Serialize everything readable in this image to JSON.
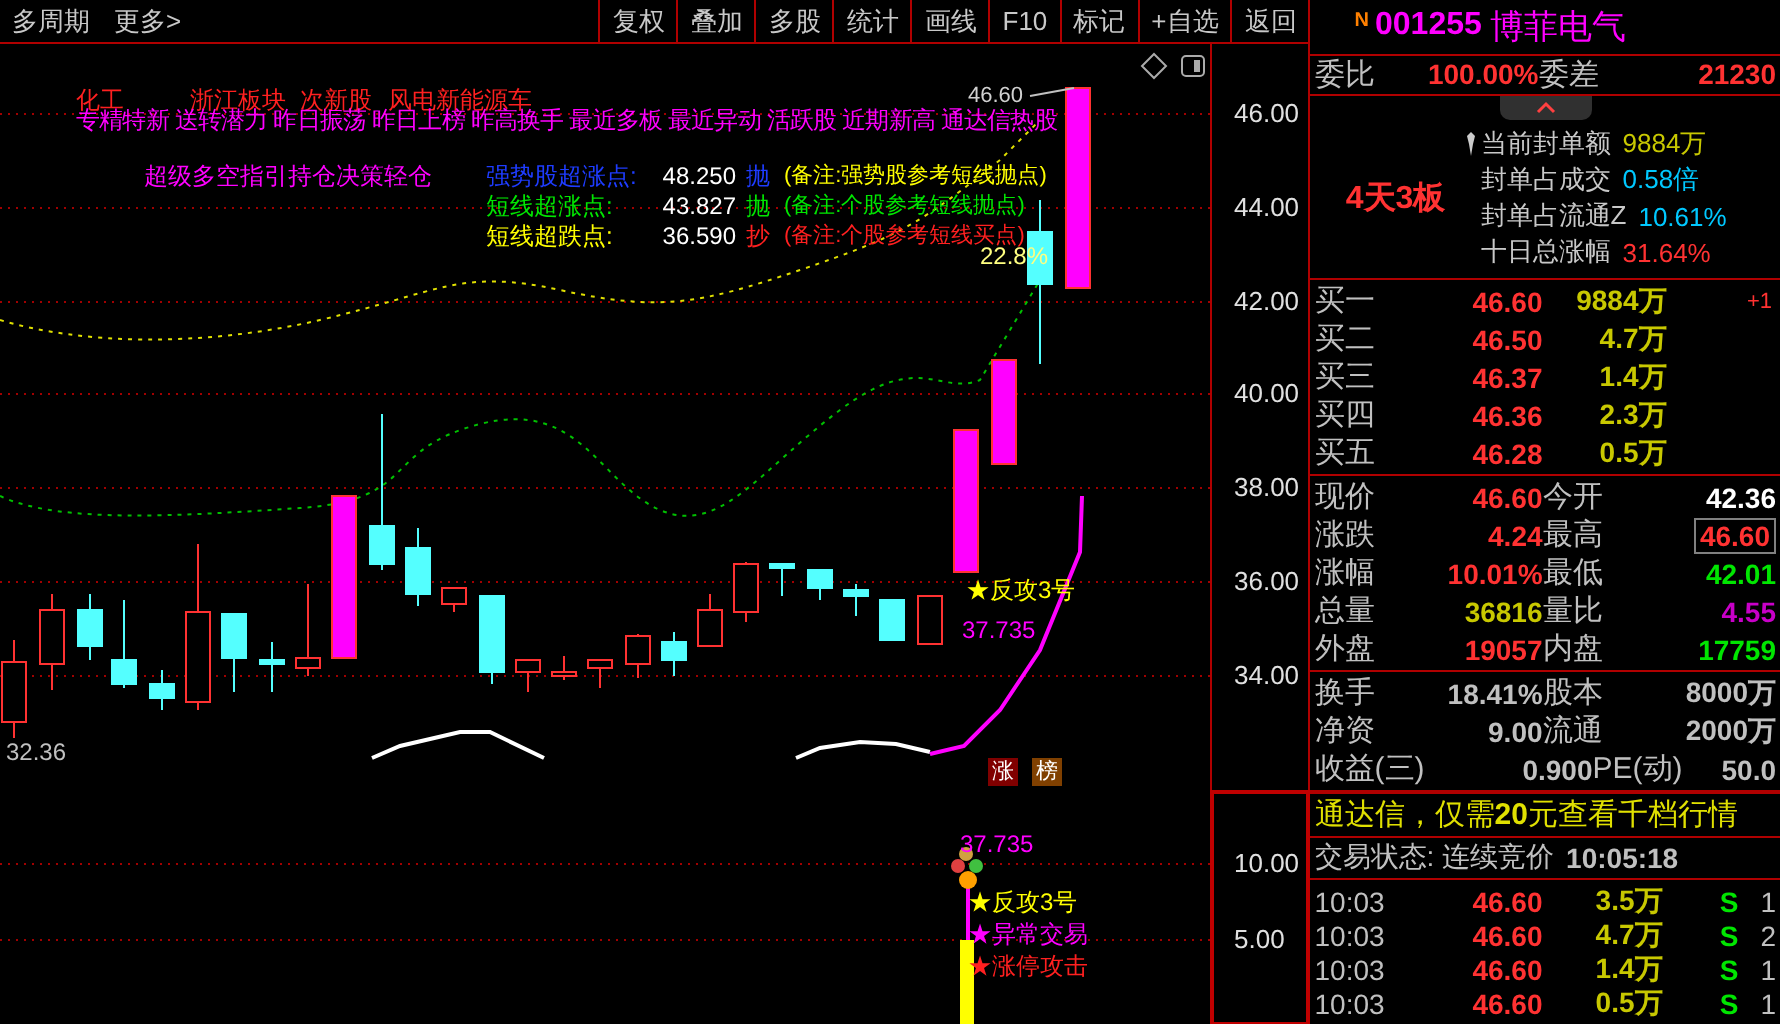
{
  "toolbar": {
    "left": [
      "多周期",
      "更多>"
    ],
    "buttons": [
      "复权",
      "叠加",
      "多股",
      "统计",
      "画线",
      "F10",
      "标记",
      "+自选",
      "返回"
    ]
  },
  "chart": {
    "price_axis": [
      "46.00",
      "44.00",
      "42.00",
      "40.00",
      "38.00",
      "36.00",
      "34.00"
    ],
    "concept_tags": [
      "化工",
      "浙江板块",
      "次新股",
      "风电",
      "新能源车"
    ],
    "feature_tags": "专精特新 送转潜力 昨日振荡 昨日上榜 昨高换手 最近多板 最近异动 活跃股 近期新高 通达信热股",
    "indicator_title": "超级多空指引持仓决策轻仓",
    "signals": [
      {
        "kind": "strong",
        "label": "强势股超涨点:",
        "value": "48.250",
        "action": "抛",
        "note": "(备注:强势股参考短线抛点)"
      },
      {
        "kind": "short_up",
        "label": "短线超涨点:",
        "value": "43.827",
        "action": "抛",
        "note": "(备注:个股参考短线抛点)"
      },
      {
        "kind": "short_down",
        "label": "短线超跌点:",
        "value": "36.590",
        "action": "抄",
        "note": "(备注:个股参考短线买点)"
      }
    ],
    "high_label": "46.60",
    "pct_label": "22.8%",
    "low_label": "32.36",
    "signal_label": "★反攻3号",
    "signal_value": "37.735",
    "badges": [
      "涨",
      "榜"
    ]
  },
  "sub_chart": {
    "axis": [
      "10.00",
      "5.00"
    ],
    "value": "37.735",
    "signals": [
      {
        "kind": "counter",
        "text": "★反攻3号"
      },
      {
        "kind": "abnormal",
        "text": "★异常交易"
      },
      {
        "kind": "limit",
        "text": "★涨停攻击"
      }
    ]
  },
  "quote": {
    "badge": "N",
    "code": "001255",
    "name": "博菲电气",
    "order_ratio": {
      "label": "委比",
      "value": "100.00%",
      "diff_label": "委差",
      "diff": "21230"
    },
    "board_tag": "4天3板",
    "seal": [
      {
        "label": "当前封单额",
        "value": "9884万",
        "kind": "volume"
      },
      {
        "label": "封单占成交",
        "value": "0.58倍",
        "kind": "info"
      },
      {
        "label": "封单占流通Z",
        "value": "10.61%",
        "kind": "info"
      },
      {
        "label": "十日总涨幅",
        "value": "31.64%",
        "kind": "up"
      }
    ],
    "bids": [
      {
        "label": "买一",
        "price": "46.60",
        "volume": "9884万",
        "change": "+1"
      },
      {
        "label": "买二",
        "price": "46.50",
        "volume": "4.7万"
      },
      {
        "label": "买三",
        "price": "46.37",
        "volume": "1.4万"
      },
      {
        "label": "买四",
        "price": "46.36",
        "volume": "2.3万"
      },
      {
        "label": "买五",
        "price": "46.28",
        "volume": "0.5万"
      }
    ],
    "stats": [
      [
        {
          "label": "现价",
          "value": "46.60",
          "kind": "up",
          "highlighted": false
        },
        {
          "label": "今开",
          "value": "42.36",
          "kind": "flat",
          "highlighted": false
        }
      ],
      [
        {
          "label": "涨跌",
          "value": "4.24",
          "kind": "up",
          "highlighted": false
        },
        {
          "label": "最高",
          "value": "46.60",
          "kind": "up",
          "highlighted": true
        }
      ],
      [
        {
          "label": "涨幅",
          "value": "10.01%",
          "kind": "up",
          "highlighted": false
        },
        {
          "label": "最低",
          "value": "42.01",
          "kind": "down",
          "highlighted": false
        }
      ],
      [
        {
          "label": "总量",
          "value": "36816",
          "kind": "volume",
          "highlighted": false
        },
        {
          "label": "量比",
          "value": "4.55",
          "kind": "ratio",
          "highlighted": false
        }
      ],
      [
        {
          "label": "外盘",
          "value": "19057",
          "kind": "up",
          "highlighted": false
        },
        {
          "label": "内盘",
          "value": "17759",
          "kind": "down",
          "highlighted": false
        }
      ]
    ],
    "fundamentals": [
      [
        {
          "label": "换手",
          "value": "18.41%"
        },
        {
          "label": "股本",
          "value": "8000万"
        }
      ],
      [
        {
          "label": "净资",
          "value": "9.00"
        },
        {
          "label": "流通",
          "value": "2000万"
        }
      ],
      [
        {
          "label": "收益(三)",
          "value": "0.900"
        },
        {
          "label": "PE(动)",
          "value": "50.0"
        }
      ]
    ],
    "promo": "通达信，仅需**20**元查看千档行情",
    "status_label": "交易状态: 连续竞价",
    "status_time": "10:05:18",
    "ticks": [
      {
        "time": "10:03",
        "price": "46.60",
        "volume": "3.5万",
        "side": "S",
        "count": "1"
      },
      {
        "time": "10:03",
        "price": "46.60",
        "volume": "4.7万",
        "side": "S",
        "count": "2"
      },
      {
        "time": "10:03",
        "price": "46.60",
        "volume": "1.4万",
        "side": "S",
        "count": "1"
      },
      {
        "time": "10:03",
        "price": "46.60",
        "volume": "0.5万",
        "side": "S",
        "count": "1"
      }
    ]
  }
}
